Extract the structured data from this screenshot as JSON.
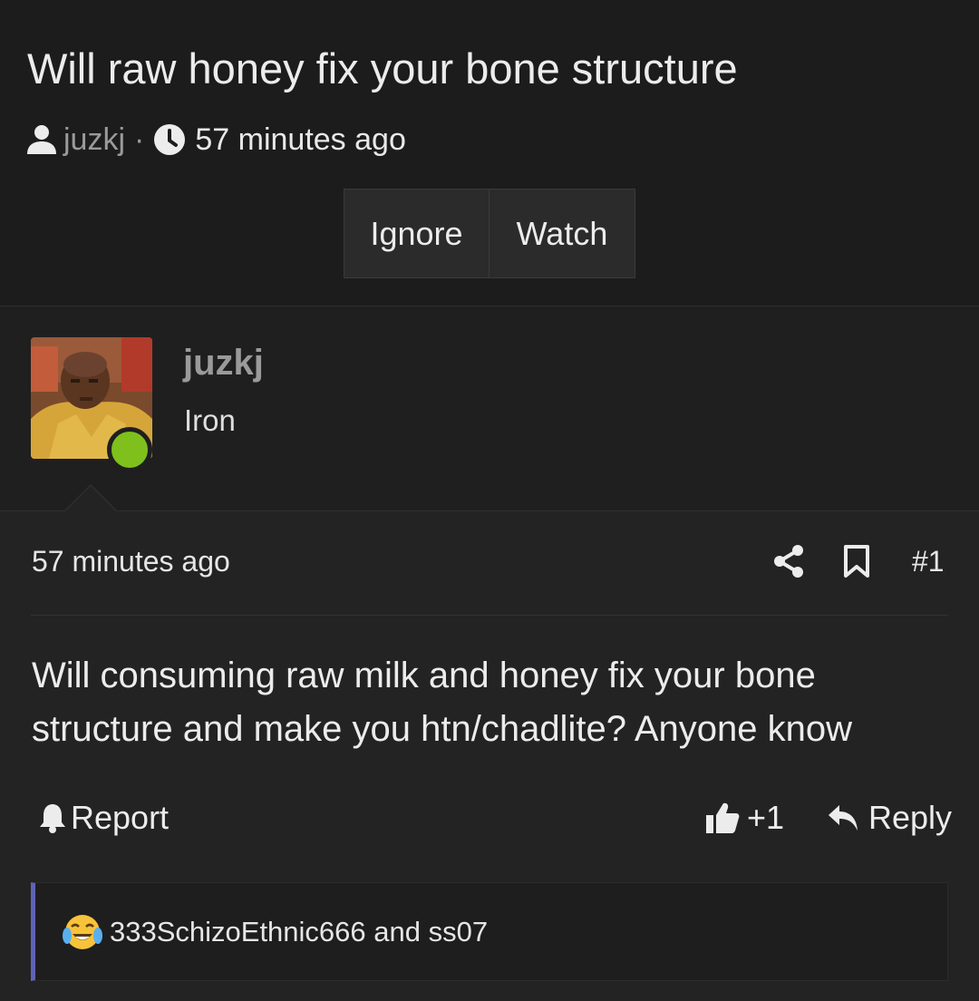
{
  "thread": {
    "title": "Will raw honey fix your bone structure",
    "author": "juzkj",
    "separator": "·",
    "time": "57 minutes ago",
    "buttons": {
      "ignore": "Ignore",
      "watch": "Watch"
    }
  },
  "user": {
    "name": "juzkj",
    "title": "Iron",
    "online": true,
    "online_color": "#7fc01c"
  },
  "post": {
    "time": "57 minutes ago",
    "number": "#1",
    "body_line1": "Will consuming raw milk and honey fix your bone",
    "body_line2": "structure and make you htn/chadlite? Anyone know",
    "actions": {
      "report": "Report",
      "like_count": "+1",
      "reply": "Reply"
    }
  },
  "reactions": {
    "emoji": "tears-of-joy-emoji",
    "text": "333SchizoEthnic666 and ss07",
    "bar_color": "#5f63b8"
  },
  "icons": {
    "author": "user-icon",
    "time": "clock-icon",
    "share": "share-icon",
    "bookmark": "bookmark-icon",
    "report": "bell-icon",
    "like": "thumbs-up-icon",
    "reply": "reply-arrow-icon"
  }
}
